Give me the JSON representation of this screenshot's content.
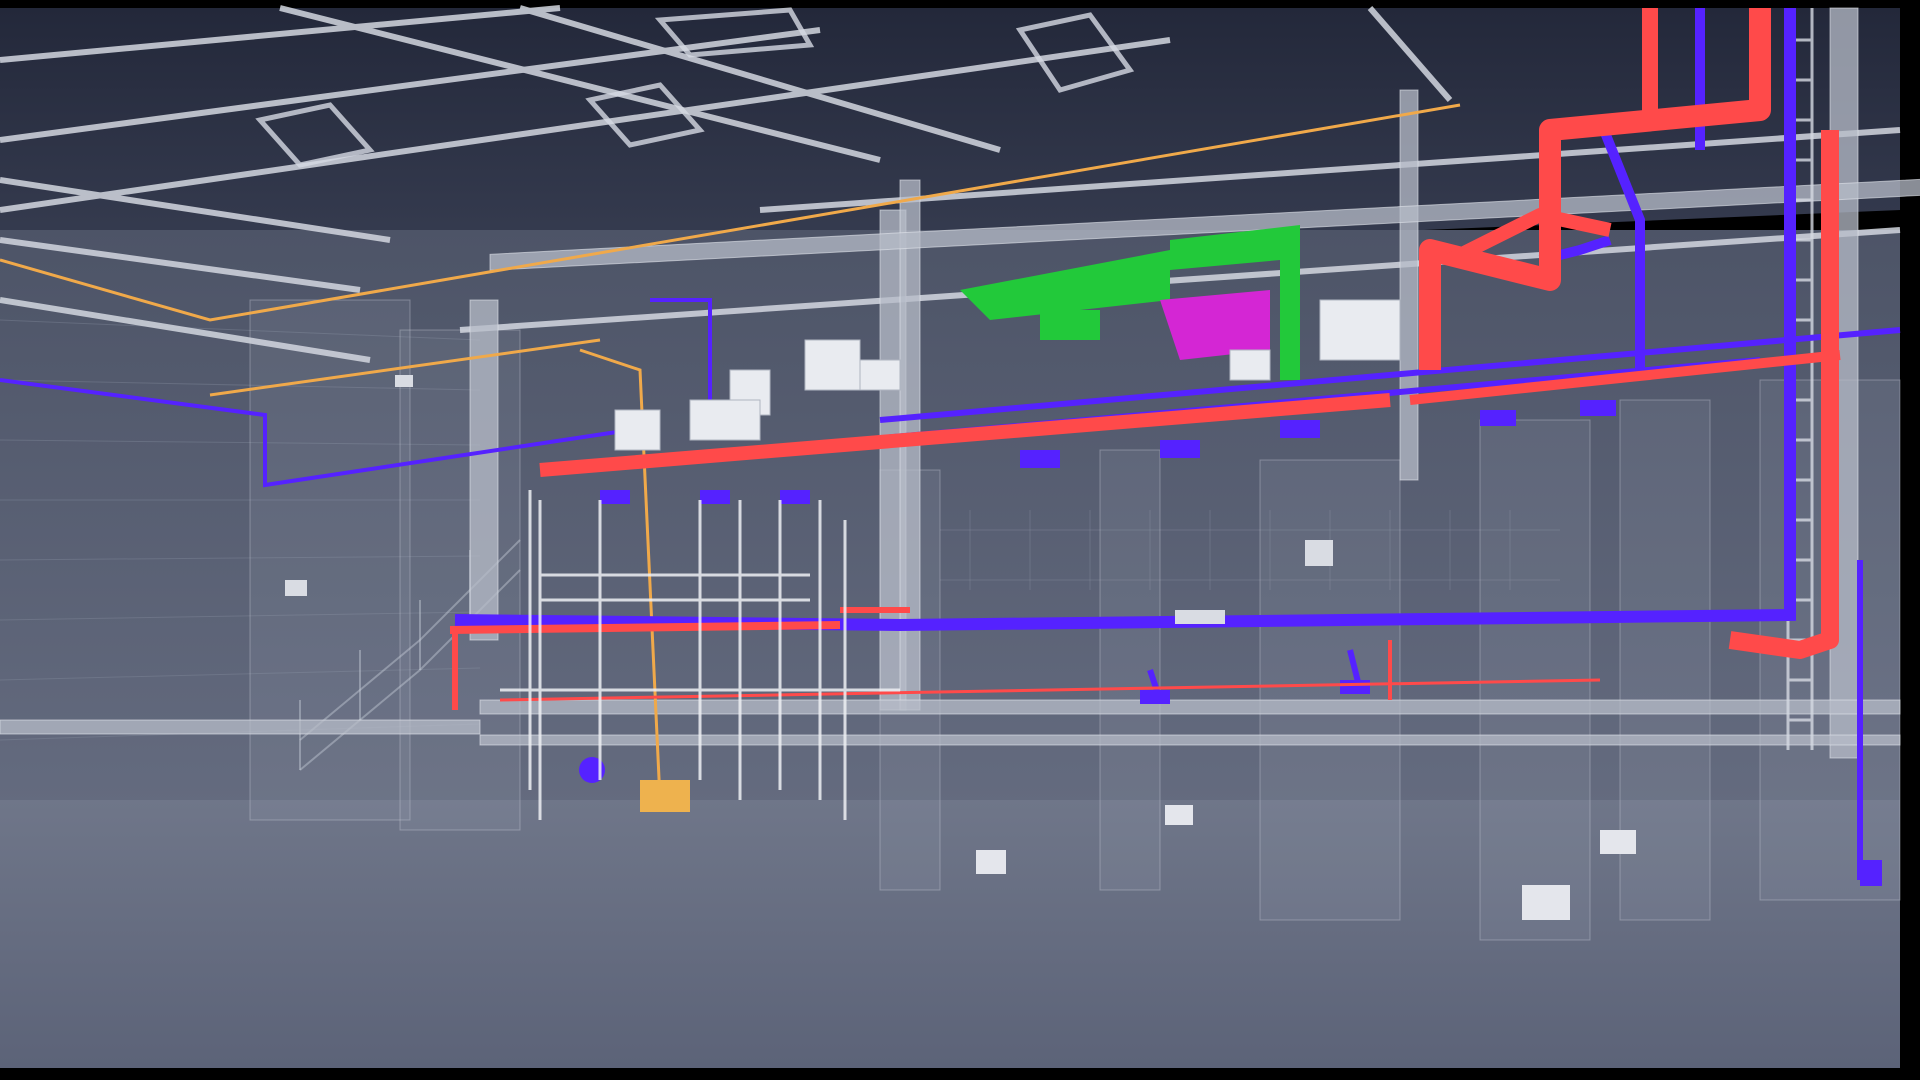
{
  "scene": {
    "description_free": true,
    "colors": {
      "frame": "#000000",
      "ceiling": "#2b3040",
      "wall": "#5b6275",
      "floor": "#6c7388",
      "structure": "#c9ced9",
      "duct_supply": "#ff4a4a",
      "duct_return": "#5522ff",
      "duct_exhaust": "#22c93a",
      "duct_magenta": "#d426d4",
      "pipe_gas": "#f0a94a",
      "equipment": "#e9ebf0",
      "equipment_yellow": "#eeb24e"
    },
    "systems": [
      {
        "name_icon": "supply-duct-icon",
        "color": "#ff4a4a"
      },
      {
        "name_icon": "return-duct-icon",
        "color": "#5522ff"
      },
      {
        "name_icon": "exhaust-duct-icon",
        "color": "#22c93a"
      },
      {
        "name_icon": "gas-pipe-icon",
        "color": "#f0a94a"
      }
    ]
  }
}
